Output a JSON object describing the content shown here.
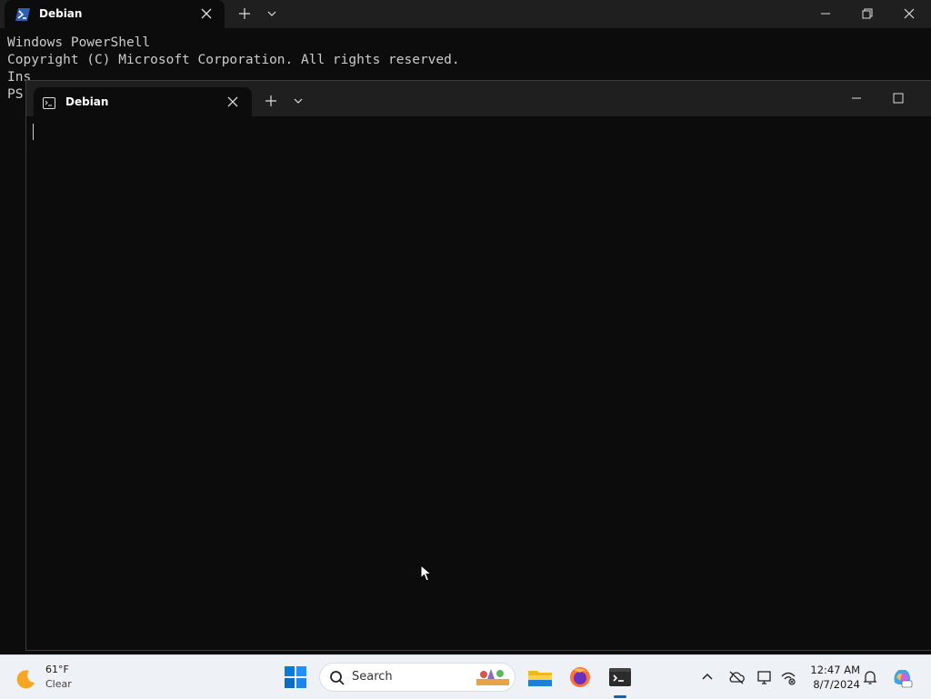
{
  "back_window": {
    "tab_title": "Debian",
    "terminal_lines": [
      "Windows PowerShell",
      "Copyright (C) Microsoft Corporation. All rights reserved.",
      "",
      "Ins",
      "",
      "PS "
    ]
  },
  "front_window": {
    "tab_title": "Debian"
  },
  "taskbar": {
    "weather": {
      "temperature": "61°F",
      "condition": "Clear",
      "icon": "moon-icon"
    },
    "search_placeholder": "Search",
    "apps": [
      "start-icon",
      "file-explorer-icon",
      "firefox-icon",
      "terminal-icon"
    ],
    "tray_icons": [
      "chevron-up-icon",
      "onedrive-icon",
      "display-icon",
      "network-icon",
      "notification-bell-icon",
      "copilot-icon"
    ],
    "clock": {
      "time": "12:47 AM",
      "date": "8/7/2024"
    }
  },
  "colors": {
    "terminal_bg": "#0c0c0c",
    "titlebar_bg": "#1f1f1f",
    "taskbar_bg": "#eef1f6",
    "accent": "#0067c0"
  }
}
